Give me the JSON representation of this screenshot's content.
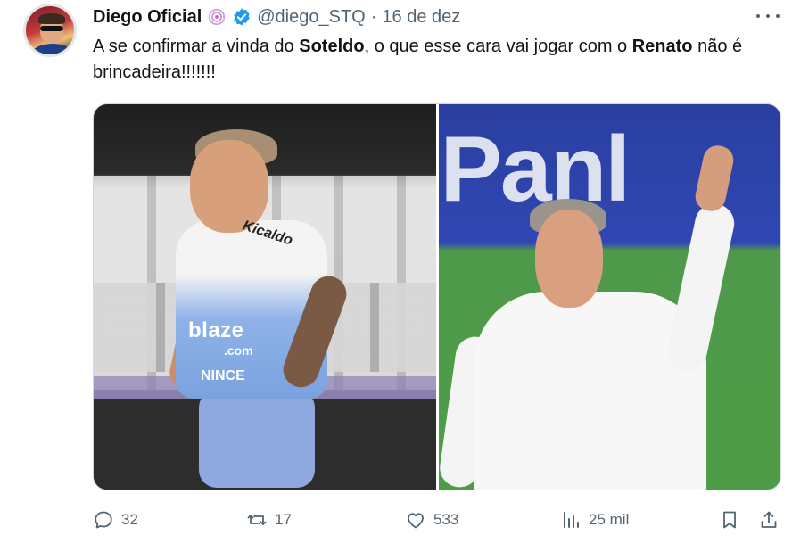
{
  "tweet": {
    "author": {
      "display_name": "Diego Oficial",
      "handle": "@diego_STQ",
      "separator": "·",
      "date": "16 de dez",
      "badges": [
        "spiral-icon",
        "verified-icon"
      ]
    },
    "text": {
      "part1": "A se confirmar a vinda do ",
      "bold1": "Soteldo",
      "part2": ", o que esse cara vai jogar com o ",
      "bold2": "Renato",
      "part3": " não é brincadeira!!!!!!!"
    },
    "media": {
      "left": {
        "chest_text": "Kicaldo",
        "sponsor_main": "blaze",
        "sponsor_sub": ".com",
        "sponsor_shorts": "NINCE"
      },
      "right": {
        "banner_text": "Panl"
      }
    },
    "actions": {
      "replies": "32",
      "retweets": "17",
      "likes": "533",
      "views": "25 mil"
    },
    "colors": {
      "text_primary": "#0f1419",
      "text_secondary": "#536471",
      "verified": "#1d9bf0",
      "border": "#cfd9de"
    }
  }
}
